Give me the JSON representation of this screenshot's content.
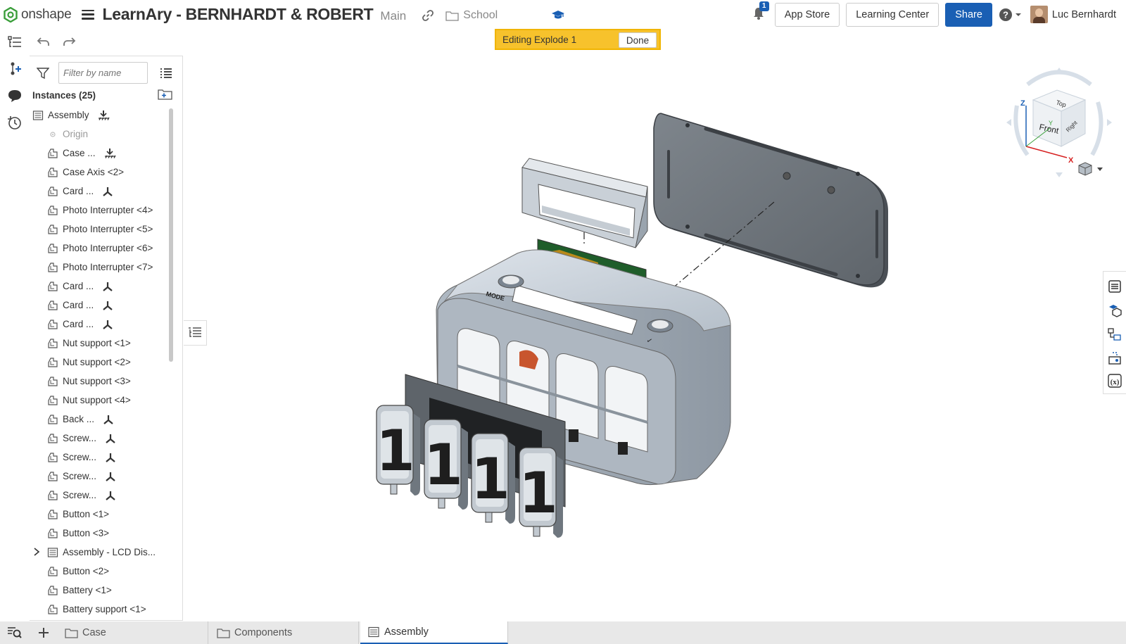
{
  "app": {
    "logo_text": "onshape",
    "document_title": "LearnAry - BERNHARDT & ROBERT",
    "branch": "Main",
    "folder": "School",
    "notifications_count": "1",
    "buttons": {
      "app_store": "App Store",
      "learning_center": "Learning Center",
      "share": "Share"
    },
    "user_name": "Luc Bernhardt",
    "accent_color": "#1a5fb4"
  },
  "banner": {
    "text": "Editing Explode 1",
    "done_label": "Done",
    "color": "#f7c22c"
  },
  "panel": {
    "filter_placeholder": "Filter by name",
    "instances_title": "Instances (25)",
    "items": [
      {
        "label": "Assembly",
        "icon": "assembly-icon",
        "badge": "fixed-icon"
      },
      {
        "label": "Origin",
        "icon": "origin-icon"
      },
      {
        "label": "Case ...",
        "icon": "part-icon",
        "badge": "fixed-icon"
      },
      {
        "label": "Case Axis <2>",
        "icon": "part-icon"
      },
      {
        "label": "Card ...",
        "icon": "part-icon",
        "badge": "mate-icon"
      },
      {
        "label": "Photo Interrupter <4>",
        "icon": "part-icon"
      },
      {
        "label": "Photo Interrupter <5>",
        "icon": "part-icon"
      },
      {
        "label": "Photo Interrupter <6>",
        "icon": "part-icon"
      },
      {
        "label": "Photo Interrupter <7>",
        "icon": "part-icon"
      },
      {
        "label": "Card ...",
        "icon": "part-icon",
        "badge": "mate-icon"
      },
      {
        "label": "Card ...",
        "icon": "part-icon",
        "badge": "mate-icon"
      },
      {
        "label": "Card ...",
        "icon": "part-icon",
        "badge": "mate-icon"
      },
      {
        "label": "Nut support <1>",
        "icon": "part-icon"
      },
      {
        "label": "Nut support <2>",
        "icon": "part-icon"
      },
      {
        "label": "Nut support <3>",
        "icon": "part-icon"
      },
      {
        "label": "Nut support <4>",
        "icon": "part-icon"
      },
      {
        "label": "Back ...",
        "icon": "part-icon",
        "badge": "mate-icon"
      },
      {
        "label": "Screw...",
        "icon": "part-icon",
        "badge": "mate-icon"
      },
      {
        "label": "Screw...",
        "icon": "part-icon",
        "badge": "mate-icon"
      },
      {
        "label": "Screw...",
        "icon": "part-icon",
        "badge": "mate-icon"
      },
      {
        "label": "Screw...",
        "icon": "part-icon",
        "badge": "mate-icon"
      },
      {
        "label": "Button <1>",
        "icon": "part-icon"
      },
      {
        "label": "Button <3>",
        "icon": "part-icon"
      },
      {
        "label": "Assembly - LCD Dis...",
        "icon": "assembly-icon",
        "expandable": true
      },
      {
        "label": "Button <2>",
        "icon": "part-icon"
      },
      {
        "label": "Battery <1>",
        "icon": "part-icon"
      },
      {
        "label": "Battery support <1>",
        "icon": "part-icon"
      }
    ]
  },
  "model": {
    "mode_label": "MODE",
    "digit": "1",
    "viewcube": {
      "top": "Top",
      "front": "Front",
      "right": "Right",
      "z": "Z",
      "x": "X",
      "y": "Y"
    }
  },
  "bottom_tabs": [
    {
      "label": "Case",
      "icon": "folder-icon"
    },
    {
      "label": "Components",
      "icon": "folder-icon"
    },
    {
      "label": "Assembly",
      "icon": "assembly-icon",
      "active": true
    }
  ]
}
